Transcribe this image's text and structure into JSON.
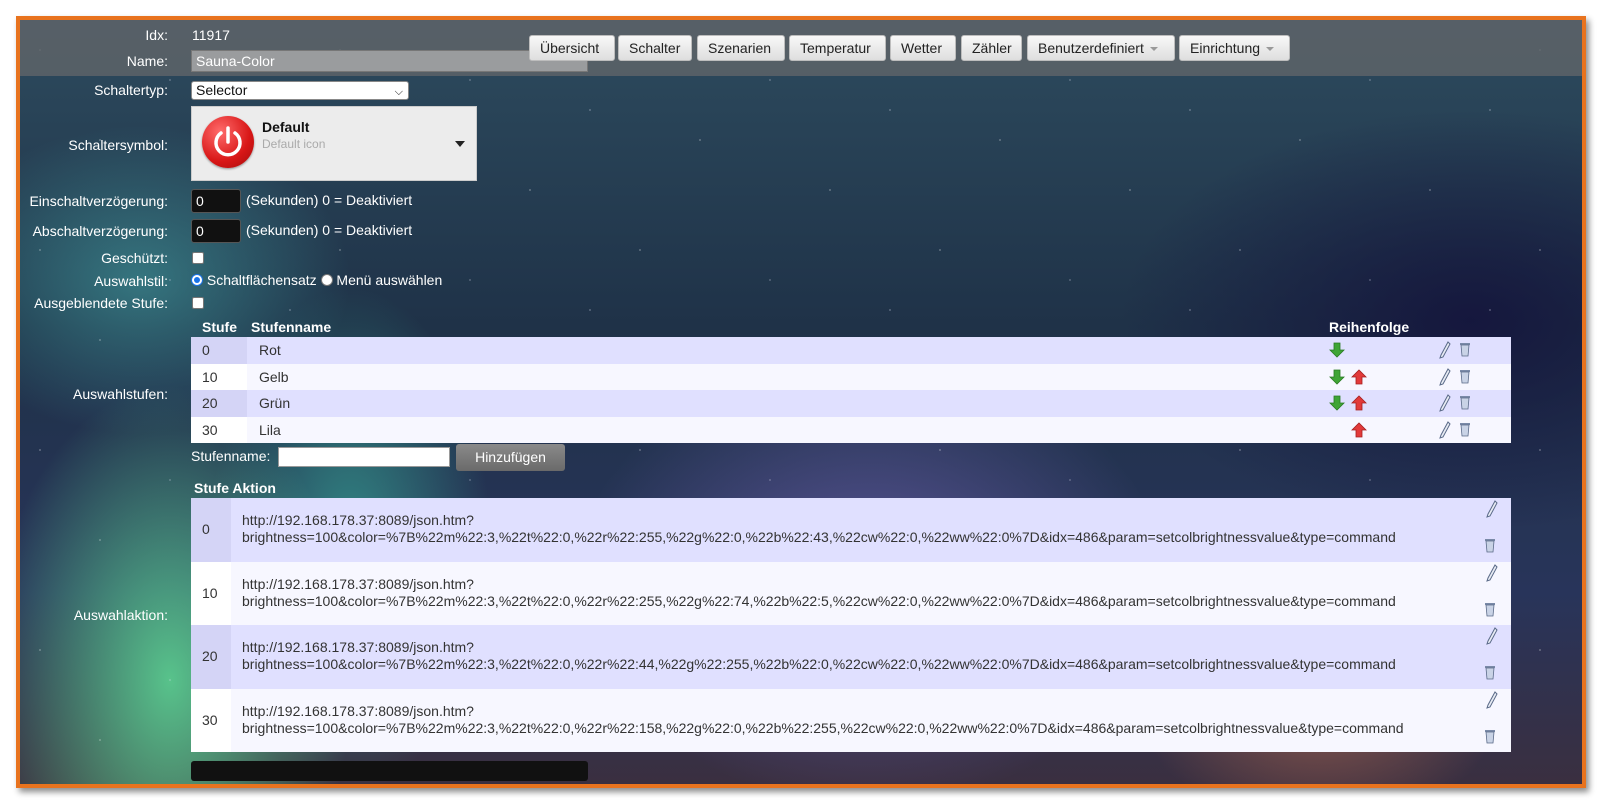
{
  "nav": {
    "buttons": [
      "Übersicht",
      "Schalter",
      "Szenarien",
      "Temperatur",
      "Wetter",
      "Zähler",
      "Benutzerdefiniert",
      "Einrichtung"
    ]
  },
  "form": {
    "idx_label": "Idx:",
    "idx_value": "11917",
    "name_label": "Name:",
    "name_value": "Sauna-Color",
    "switchtype_label": "Schaltertyp:",
    "switchtype_value": "Selector",
    "icon_label": "Schaltersymbol:",
    "icon_title": "Default",
    "icon_subtitle": "Default icon",
    "on_delay_label": "Einschaltverzögerung:",
    "on_delay_value": "0",
    "off_delay_label": "Abschaltverzögerung:",
    "off_delay_value": "0",
    "delay_hint": "(Sekunden) 0 = Deaktiviert",
    "protected_label": "Geschützt:",
    "style_label": "Auswahlstil:",
    "style_option1": "Schaltflächensatz",
    "style_option2": "Menü auswählen",
    "hidden_level_label": "Ausgeblendete Stufe:"
  },
  "levels": {
    "section_label": "Auswahlstufen:",
    "col_level": "Stufe",
    "col_name": "Stufenname",
    "col_order": "Reihenfolge",
    "rows": [
      {
        "level": "0",
        "name": "Rot"
      },
      {
        "level": "10",
        "name": "Gelb"
      },
      {
        "level": "20",
        "name": "Grün"
      },
      {
        "level": "30",
        "name": "Lila"
      }
    ],
    "add_label": "Stufenname:",
    "add_button": "Hinzufügen"
  },
  "actions": {
    "section_label": "Auswahlaktion:",
    "header": "Stufe Aktion",
    "rows": [
      {
        "level": "0",
        "line1": "http://192.168.178.37:8089/json.htm?",
        "line2": "brightness=100&color=%7B%22m%22:3,%22t%22:0,%22r%22:255,%22g%22:0,%22b%22:43,%22cw%22:0,%22ww%22:0%7D&idx=486&param=setcolbrightnessvalue&type=command"
      },
      {
        "level": "10",
        "line1": "http://192.168.178.37:8089/json.htm?",
        "line2": "brightness=100&color=%7B%22m%22:3,%22t%22:0,%22r%22:255,%22g%22:74,%22b%22:5,%22cw%22:0,%22ww%22:0%7D&idx=486&param=setcolbrightnessvalue&type=command"
      },
      {
        "level": "20",
        "line1": "http://192.168.178.37:8089/json.htm?",
        "line2": "brightness=100&color=%7B%22m%22:3,%22t%22:0,%22r%22:44,%22g%22:255,%22b%22:0,%22cw%22:0,%22ww%22:0%7D&idx=486&param=setcolbrightnessvalue&type=command"
      },
      {
        "level": "30",
        "line1": "http://192.168.178.37:8089/json.htm?",
        "line2": "brightness=100&color=%7B%22m%22:3,%22t%22:0,%22r%22:158,%22g%22:0,%22b%22:255,%22cw%22:0,%22ww%22:0%7D&idx=486&param=setcolbrightnessvalue&type=command"
      }
    ]
  },
  "colors": {
    "frame": "#e8731e",
    "arrow_down": "#3fa535",
    "arrow_up": "#e23a3a",
    "power_icon": "#d81616"
  },
  "icons": {
    "move_down": "arrow-down-icon",
    "move_up": "arrow-up-icon",
    "edit": "pencil-icon",
    "delete": "trash-icon",
    "switch_icon": "power-icon"
  }
}
